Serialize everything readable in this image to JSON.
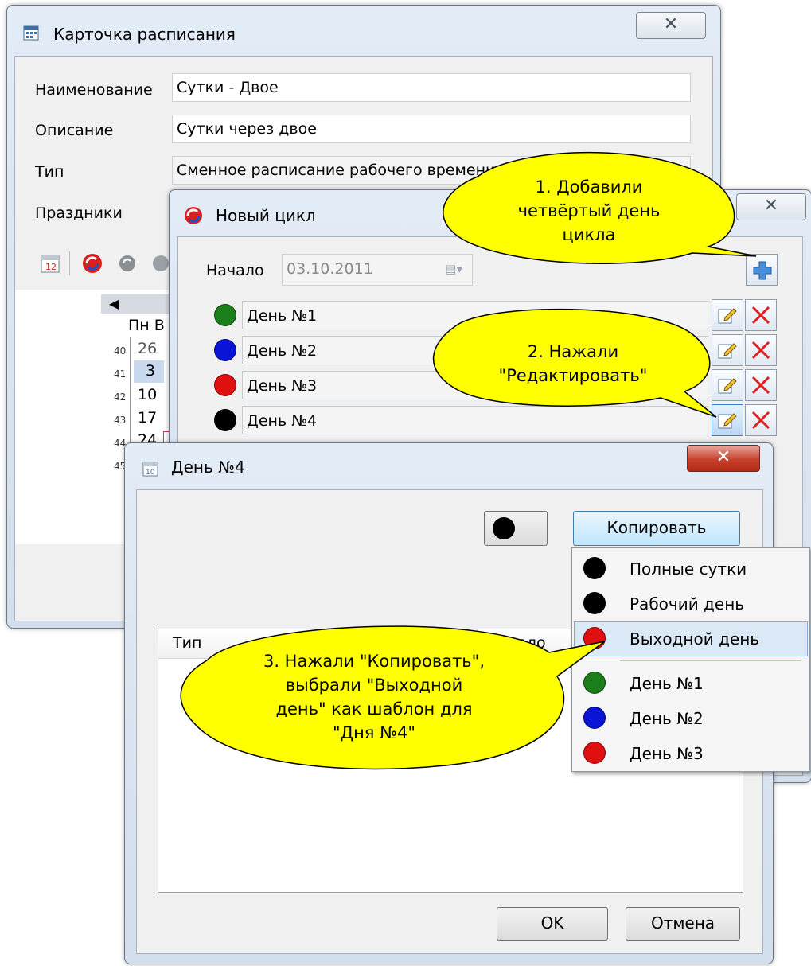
{
  "schedule_card": {
    "title": "Карточка расписания",
    "close": "✕",
    "fields": {
      "name_label": "Наименование",
      "name_value": "Сутки - Двое",
      "desc_label": "Описание",
      "desc_value": "Сутки через двое",
      "type_label": "Тип",
      "type_value": "Сменное расписание рабочего времени",
      "holidays_label": "Праздники"
    },
    "calendar": {
      "header_days": "Пн В",
      "weeks": [
        "40",
        "41",
        "42",
        "43",
        "44",
        "45"
      ],
      "days": [
        "26",
        "3",
        "10",
        "17",
        "24"
      ]
    }
  },
  "new_cycle": {
    "title": "Новый цикл",
    "close": "✕",
    "start_label": "Начало",
    "start_value": "03.10.2011",
    "days": [
      {
        "label": "День №1",
        "color": "#1a7f1a"
      },
      {
        "label": "День №2",
        "color": "#0a14d6"
      },
      {
        "label": "День №3",
        "color": "#e01010"
      },
      {
        "label": "День №4",
        "color": "#000000"
      }
    ]
  },
  "day4_dialog": {
    "title": "День №4",
    "close": "✕",
    "color_value": "#000000",
    "copy_button": "Копировать",
    "table_headers": {
      "type": "Тип",
      "start": "Начало"
    },
    "ok_button": "OK",
    "cancel_button": "Отмена"
  },
  "copy_menu": {
    "items": [
      {
        "label": "Полные сутки",
        "color": "#000000"
      },
      {
        "label": "Рабочий день",
        "color": "#000000"
      },
      {
        "label": "Выходной день",
        "color": "#e01010"
      },
      {
        "label": "День №1",
        "color": "#1a7f1a"
      },
      {
        "label": "День №2",
        "color": "#0a14d6"
      },
      {
        "label": "День №3",
        "color": "#e01010"
      }
    ]
  },
  "callouts": {
    "c1": [
      "1. Добавили",
      "четвёртый день",
      "цикла"
    ],
    "c2": [
      "2. Нажали",
      "\"Редактировать\""
    ],
    "c3": [
      "3. Нажали \"Копировать\",",
      "выбрали \"Выходной",
      "день\" как шаблон для",
      "\"Дня №4\""
    ]
  },
  "colors": {
    "callout_fill": "#ffff00",
    "selection": "#dbe8f6"
  }
}
